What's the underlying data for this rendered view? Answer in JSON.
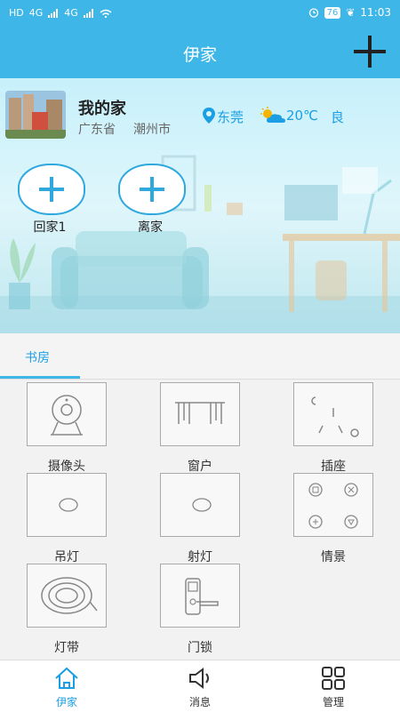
{
  "status_bar": {
    "left_indicators": [
      "HD",
      "4G",
      "4G"
    ],
    "battery": "76",
    "time": "11:03"
  },
  "header": {
    "title": "伊家"
  },
  "home": {
    "name": "我的家",
    "province": "广东省",
    "city": "潮州市",
    "location": "东莞",
    "temperature": "20℃",
    "air_quality": "良"
  },
  "scenes": [
    {
      "label": "回家1"
    },
    {
      "label": "离家"
    }
  ],
  "room_tabs": [
    {
      "label": "书房",
      "active": true
    }
  ],
  "devices": [
    {
      "label": "摄像头",
      "icon": "camera-icon"
    },
    {
      "label": "窗户",
      "icon": "curtain-icon"
    },
    {
      "label": "插座",
      "icon": "socket-icon"
    },
    {
      "label": "吊灯",
      "icon": "light-switch-icon"
    },
    {
      "label": "射灯",
      "icon": "light-switch-icon"
    },
    {
      "label": "情景",
      "icon": "scene-panel-icon"
    },
    {
      "label": "灯带",
      "icon": "light-strip-icon"
    },
    {
      "label": "门锁",
      "icon": "door-lock-icon"
    }
  ],
  "bottom_nav": [
    {
      "label": "伊家",
      "icon": "home-icon",
      "active": true
    },
    {
      "label": "消息",
      "icon": "speaker-icon"
    },
    {
      "label": "管理",
      "icon": "grid-icon"
    }
  ],
  "colors": {
    "primary": "#3fb6e8",
    "accent_text": "#1b9ee3"
  }
}
